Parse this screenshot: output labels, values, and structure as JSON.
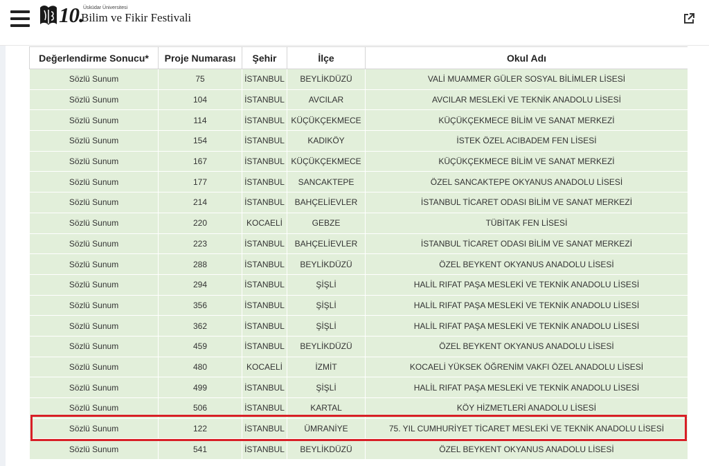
{
  "header": {
    "logo_number": "10.",
    "logo_small": "Üsküdar Üniversitesi",
    "logo_big": "Bilim ve Fikir Festivali"
  },
  "table": {
    "columns": [
      "Değerlendirme Sonucu*",
      "Proje Numarası",
      "Şehir",
      "İlçe",
      "Okul Adı"
    ],
    "rows": [
      [
        "Sözlü Sunum",
        "75",
        "İSTANBUL",
        "BEYLİKDÜZÜ",
        "VALİ MUAMMER GÜLER SOSYAL BİLİMLER LİSESİ"
      ],
      [
        "Sözlü Sunum",
        "104",
        "İSTANBUL",
        "AVCILAR",
        "AVCILAR MESLEKİ VE TEKNİK ANADOLU LİSESİ"
      ],
      [
        "Sözlü Sunum",
        "114",
        "İSTANBUL",
        "KÜÇÜKÇEKMECE",
        "KÜÇÜKÇEKMECE BİLİM VE SANAT MERKEZİ"
      ],
      [
        "Sözlü Sunum",
        "154",
        "İSTANBUL",
        "KADIKÖY",
        "İSTEK ÖZEL ACIBADEM FEN LİSESİ"
      ],
      [
        "Sözlü Sunum",
        "167",
        "İSTANBUL",
        "KÜÇÜKÇEKMECE",
        "KÜÇÜKÇEKMECE BİLİM VE SANAT MERKEZİ"
      ],
      [
        "Sözlü Sunum",
        "177",
        "İSTANBUL",
        "SANCAKTEPE",
        "ÖZEL SANCAKTEPE OKYANUS ANADOLU LİSESİ"
      ],
      [
        "Sözlü Sunum",
        "214",
        "İSTANBUL",
        "BAHÇELİEVLER",
        "İSTANBUL TİCARET ODASI BİLİM VE SANAT MERKEZİ"
      ],
      [
        "Sözlü Sunum",
        "220",
        "KOCAELİ",
        "GEBZE",
        "TÜBİTAK FEN LİSESİ"
      ],
      [
        "Sözlü Sunum",
        "223",
        "İSTANBUL",
        "BAHÇELİEVLER",
        "İSTANBUL TİCARET ODASI BİLİM VE SANAT MERKEZİ"
      ],
      [
        "Sözlü Sunum",
        "288",
        "İSTANBUL",
        "BEYLİKDÜZÜ",
        "ÖZEL BEYKENT OKYANUS ANADOLU LİSESİ"
      ],
      [
        "Sözlü Sunum",
        "294",
        "İSTANBUL",
        "ŞİŞLİ",
        "HALİL RIFAT PAŞA MESLEKİ VE TEKNİK ANADOLU LİSESİ"
      ],
      [
        "Sözlü Sunum",
        "356",
        "İSTANBUL",
        "ŞİŞLİ",
        "HALİL RIFAT PAŞA MESLEKİ VE TEKNİK ANADOLU LİSESİ"
      ],
      [
        "Sözlü Sunum",
        "362",
        "İSTANBUL",
        "ŞİŞLİ",
        "HALİL RIFAT PAŞA MESLEKİ VE TEKNİK ANADOLU LİSESİ"
      ],
      [
        "Sözlü Sunum",
        "459",
        "İSTANBUL",
        "BEYLİKDÜZÜ",
        "ÖZEL BEYKENT OKYANUS ANADOLU LİSESİ"
      ],
      [
        "Sözlü Sunum",
        "480",
        "KOCAELİ",
        "İZMİT",
        "KOCAELİ YÜKSEK ÖĞRENİM VAKFI ÖZEL ANADOLU LİSESİ"
      ],
      [
        "Sözlü Sunum",
        "499",
        "İSTANBUL",
        "ŞİŞLİ",
        "HALİL RIFAT PAŞA MESLEKİ VE TEKNİK ANADOLU LİSESİ"
      ],
      [
        "Sözlü Sunum",
        "506",
        "İSTANBUL",
        "KARTAL",
        "KÖY HİZMETLERİ ANADOLU LİSESİ"
      ],
      [
        "Sözlü Sunum",
        "122",
        "İSTANBUL",
        "ÜMRANİYE",
        "75. YIL CUMHURİYET TİCARET MESLEKİ VE TEKNİK ANADOLU LİSESİ"
      ],
      [
        "Sözlü Sunum",
        "541",
        "İSTANBUL",
        "BEYLİKDÜZÜ",
        "ÖZEL BEYKENT OKYANUS ANADOLU LİSESİ"
      ]
    ]
  },
  "highlight_color": "#d81f26",
  "row_color": "#e2efda",
  "icons": {
    "menu": "hamburger-menu-icon",
    "external": "external-link-icon",
    "logo": "festival-logo-icon"
  }
}
